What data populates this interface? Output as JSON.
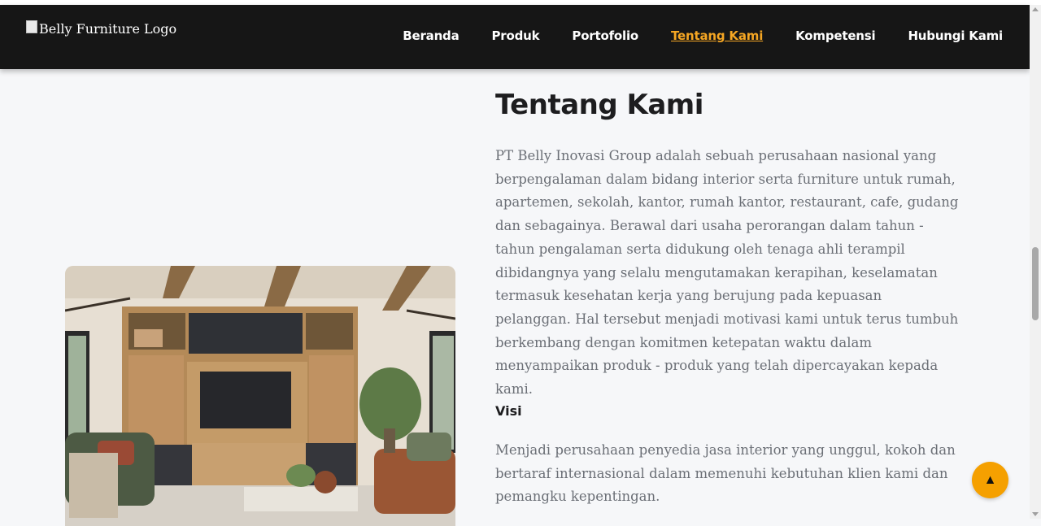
{
  "header": {
    "logo_alt": "Belly Furniture Logo",
    "nav": [
      {
        "label": "Beranda",
        "active": false
      },
      {
        "label": "Produk",
        "active": false
      },
      {
        "label": "Portofolio",
        "active": false
      },
      {
        "label": "Tentang Kami",
        "active": true
      },
      {
        "label": "Kompetensi",
        "active": false
      },
      {
        "label": "Hubungi Kami",
        "active": false
      }
    ]
  },
  "about": {
    "title": "Tentang Kami",
    "description": "PT Belly Inovasi Group adalah sebuah perusahaan nasional yang berpengalaman dalam bidang interior serta furniture untuk rumah, apartemen, sekolah, kantor, rumah kantor, restaurant, cafe, gudang dan sebagainya. Berawal dari usaha perorangan dalam tahun - tahun pengalaman serta didukung oleh tenaga ahli terampil dibidangnya yang selalu mengutamakan kerapihan, keselamatan termasuk kesehatan kerja yang berujung pada kepuasan pelanggan. Hal tersebut menjadi motivasi kami untuk terus tumbuh berkembang dengan komitmen ketepatan waktu dalam menyampaikan produk - produk yang telah dipercayakan kepada kami.",
    "visi_heading": "Visi",
    "visi_text": "Menjadi perusahaan penyedia jasa interior yang unggul, kokoh dan bertaraf internasional dalam memenuhi kebutuhan klien kami dan pemangku kepentingan."
  },
  "scroll_top": {
    "icon": "▲"
  },
  "colors": {
    "nav_bg": "#161616",
    "accent": "#f5a623",
    "button": "#f5a000"
  }
}
